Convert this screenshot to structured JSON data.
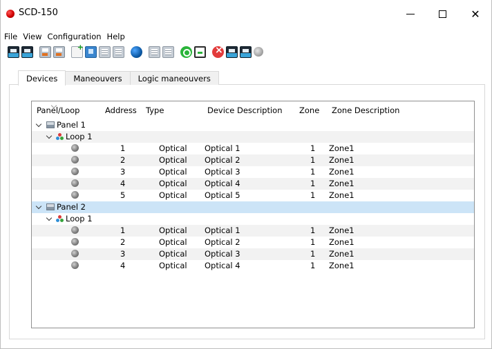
{
  "window": {
    "title": "SCD-150",
    "minimize_label": "",
    "maximize_label": "",
    "close_label": "✕"
  },
  "menu": [
    "File",
    "View",
    "Configuration",
    "Help"
  ],
  "toolbar": {
    "icons": [
      "monitor-icon",
      "monitor-icon",
      "save-file-icon",
      "save-file-icon",
      "new-document-icon",
      "blue-file-icon",
      "grid-icon",
      "grid-icon",
      "globe-icon",
      "grid-icon",
      "grid-icon",
      "power-icon",
      "clipboard-icon",
      "stop-icon",
      "monitor-icon",
      "monitor-icon",
      "search-icon"
    ]
  },
  "tabs": [
    "Devices",
    "Maneouvers",
    "Logic maneouvers"
  ],
  "active_tab": "Devices",
  "columns": [
    "Panel/Loop",
    "Address",
    "Type",
    "Device Description",
    "Zone",
    "Zone Description"
  ],
  "tree": {
    "panel1": {
      "label": "Panel 1",
      "loop": "Loop 1",
      "devices": [
        {
          "address": "1",
          "type": "Optical",
          "description": "Optical 1",
          "zone": "1",
          "zone_description": "Zone1"
        },
        {
          "address": "2",
          "type": "Optical",
          "description": "Optical 2",
          "zone": "1",
          "zone_description": "Zone1"
        },
        {
          "address": "3",
          "type": "Optical",
          "description": "Optical 3",
          "zone": "1",
          "zone_description": "Zone1"
        },
        {
          "address": "4",
          "type": "Optical",
          "description": "Optical 4",
          "zone": "1",
          "zone_description": "Zone1"
        },
        {
          "address": "5",
          "type": "Optical",
          "description": "Optical 5",
          "zone": "1",
          "zone_description": "Zone1"
        }
      ]
    },
    "panel2": {
      "label": "Panel 2",
      "loop": "Loop 1",
      "devices": [
        {
          "address": "1",
          "type": "Optical",
          "description": "Optical 1",
          "zone": "1",
          "zone_description": "Zone1"
        },
        {
          "address": "2",
          "type": "Optical",
          "description": "Optical 2",
          "zone": "1",
          "zone_description": "Zone1"
        },
        {
          "address": "3",
          "type": "Optical",
          "description": "Optical 3",
          "zone": "1",
          "zone_description": "Zone1"
        },
        {
          "address": "4",
          "type": "Optical",
          "description": "Optical 4",
          "zone": "1",
          "zone_description": "Zone1"
        }
      ]
    }
  },
  "colors": {
    "selected_row": "#cce4f7",
    "alt_row": "#f2f2f2",
    "app_icon": "#d10000"
  }
}
